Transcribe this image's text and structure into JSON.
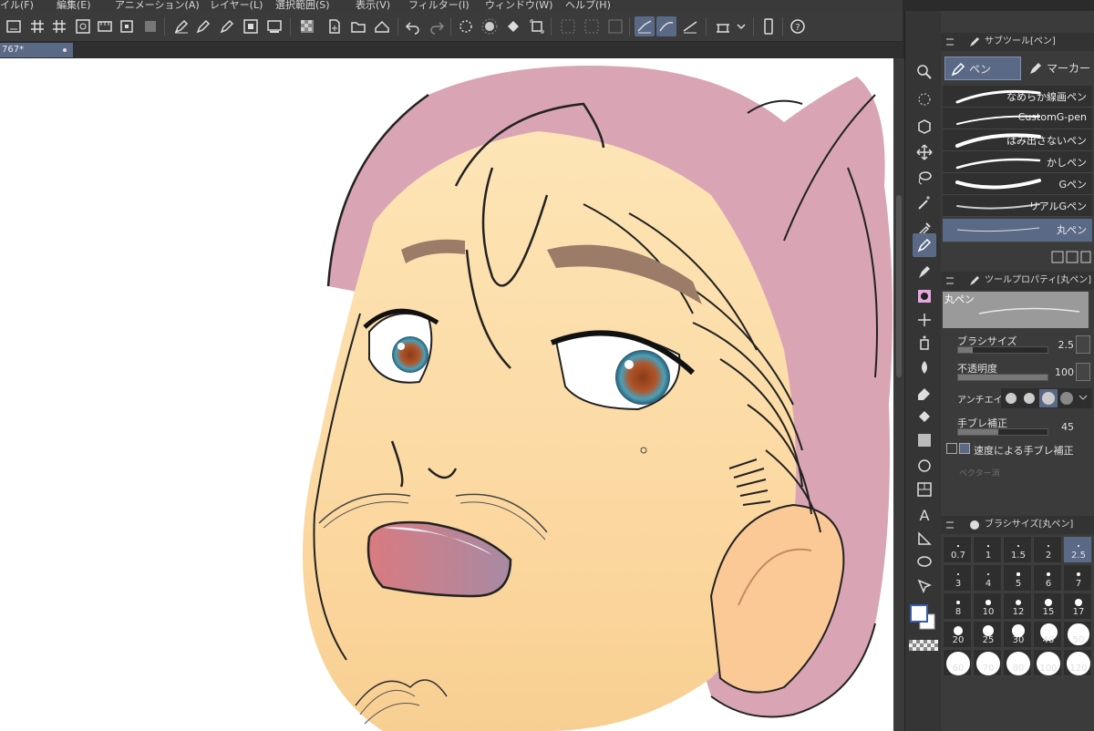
{
  "menu": [
    "イル(F)",
    "編集(E)",
    "アニメーション(A)",
    "レイヤー(L)",
    "選択範囲(S)",
    "表示(V)",
    "フィルター(I)",
    "ウィンドウ(W)",
    "ヘルプ(H)"
  ],
  "document_tab": {
    "title": "767*"
  },
  "sub_tool_panel": {
    "title": "サブツール[ペン]",
    "tabs": [
      {
        "label": "ペン",
        "active": true
      },
      {
        "label": "マーカー",
        "active": false
      }
    ],
    "brushes": [
      "なめらか線画ペン",
      "CustomG-pen",
      "はみ出さないペン",
      "かしペン",
      "Gペン",
      "リアルGペン",
      "丸ペン"
    ],
    "selected_brush": "丸ペン"
  },
  "tool_property_panel": {
    "title": "ツールプロパティ[丸ペン]",
    "preview_label": "丸ペン",
    "brush_size_label": "ブラシサイズ",
    "brush_size_value": "2.5",
    "opacity_label": "不透明度",
    "opacity_value": "100",
    "antialias_label": "アンチエイリ",
    "stabilization_label": "手ブレ補正",
    "stabilization_value": "45",
    "speed_stabilization_label": "速度による手ブレ補正",
    "vector_eraser_label": "ベクター消"
  },
  "brush_size_panel": {
    "title": "ブラシサイズ[丸ペン]",
    "sizes": [
      "0.7",
      "1",
      "1.5",
      "2",
      "2.5",
      "3",
      "4",
      "5",
      "6",
      "7",
      "8",
      "10",
      "12",
      "15",
      "17",
      "20",
      "25",
      "30",
      "40",
      "50",
      "60",
      "70",
      "80",
      "100",
      "120"
    ],
    "selected": "2.5"
  },
  "colors": {
    "accent": "#5a6986",
    "hair": "#d9a5b4",
    "skin": "#fde3b4",
    "panel_bg": "#3b3b3b"
  }
}
